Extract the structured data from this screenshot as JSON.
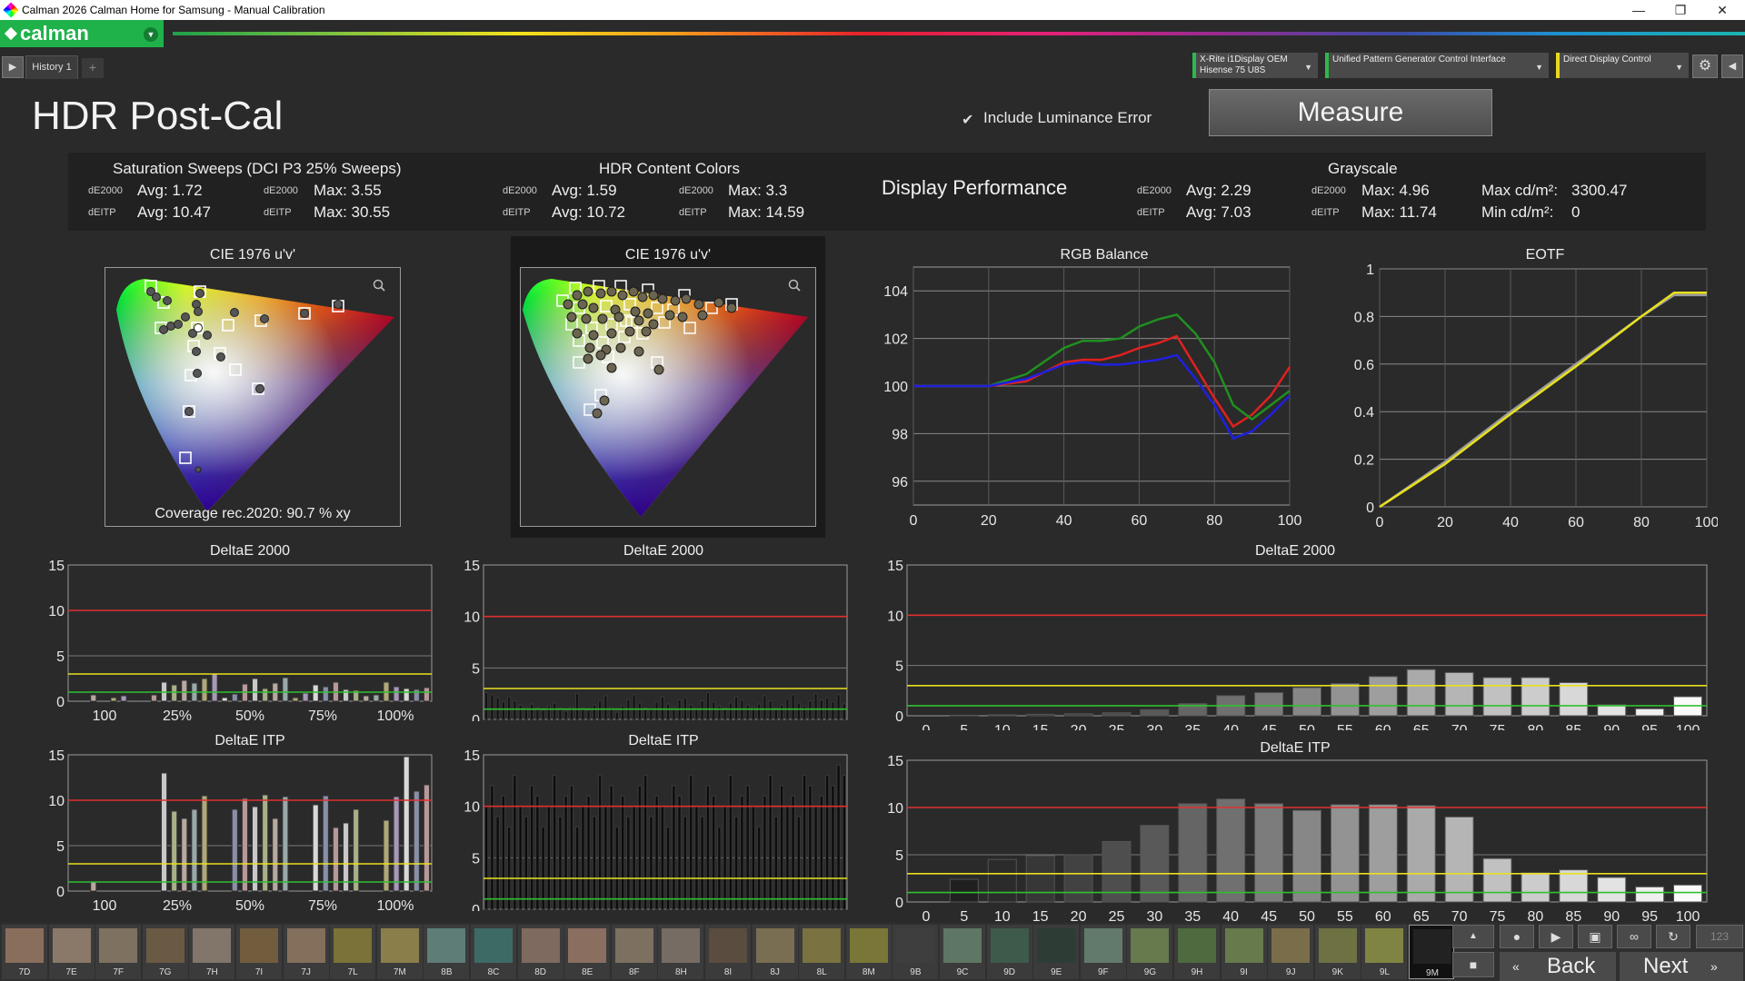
{
  "window": {
    "title": "Calman 2026 Calman Home for Samsung  - Manual Calibration",
    "minimize": "—",
    "maximize": "❐",
    "close": "✕"
  },
  "brand": {
    "logo_text": "calman",
    "accent": "#1fb24a"
  },
  "tabs": {
    "play_icon": "▶",
    "history_label": "History 1",
    "add_label": "+"
  },
  "devices": [
    {
      "line1": "X-Rite i1Display OEM",
      "line2": "Hisense 75 U8S"
    },
    {
      "line1": "Unified Pattern Generator Control Interface",
      "line2": ""
    },
    {
      "line1": "Direct Display Control",
      "line2": ""
    }
  ],
  "header": {
    "page_title": "HDR Post-Cal",
    "include_luminance_label": "Include Luminance Error",
    "include_luminance_checked": true,
    "measure_label": "Measure"
  },
  "summary": {
    "sat_sweeps": {
      "title": "Saturation Sweeps (DCI P3 25% Sweeps)",
      "de2000_label": "dE2000",
      "deitp_label": "dEITP",
      "de2000_avg": "Avg: 1.72",
      "de2000_max": "Max: 3.55",
      "deitp_avg": "Avg: 10.47",
      "deitp_max": "Max: 30.55"
    },
    "hdr_colors": {
      "title": "HDR Content Colors",
      "de2000_label": "dE2000",
      "deitp_label": "dEITP",
      "de2000_avg": "Avg: 1.59",
      "de2000_max": "Max: 3.3",
      "deitp_avg": "Avg: 10.72",
      "deitp_max": "Max: 14.59"
    },
    "display_performance": "Display Performance",
    "grayscale": {
      "title": "Grayscale",
      "de2000_label": "dE2000",
      "deitp_label": "dEITP",
      "de2000_avg": "Avg: 2.29",
      "de2000_max": "Max: 4.96",
      "deitp_avg": "Avg: 7.03",
      "deitp_max": "Max: 11.74",
      "max_cd_label": "Max cd/m²:",
      "max_cd": "3300.47",
      "min_cd_label": "Min cd/m²:",
      "min_cd": "0"
    }
  },
  "cie_left": {
    "title": "CIE 1976 u'v'",
    "coverage": "Coverage rec.2020:  90.7 % xy",
    "zoom_icon": "magnifier-icon"
  },
  "cie_right": {
    "title": "CIE 1976 u'v'",
    "zoom_icon": "magnifier-icon"
  },
  "panel_titles": {
    "rgb": "RGB Balance",
    "eotf": "EOTF",
    "sat_de2000": "DeltaE 2000",
    "sat_deitp": "DeltaE ITP",
    "hdr_de2000": "DeltaE 2000",
    "hdr_deitp": "DeltaE ITP",
    "gs_de2000": "DeltaE 2000",
    "gs_deitp": "DeltaE ITP"
  },
  "chart_data": [
    {
      "type": "line",
      "title": "RGB Balance",
      "x": [
        0,
        10,
        20,
        30,
        40,
        45,
        50,
        55,
        60,
        65,
        70,
        75,
        80,
        85,
        90,
        95,
        100
      ],
      "series": [
        {
          "color": "#e02020",
          "values": [
            100,
            100,
            100,
            100.2,
            101,
            101.1,
            101.1,
            101.3,
            101.6,
            101.8,
            102.1,
            100.8,
            99.5,
            98.3,
            98.8,
            99.6,
            100.8
          ]
        },
        {
          "color": "#209020",
          "values": [
            100,
            100,
            100,
            100.5,
            101.6,
            101.9,
            101.9,
            102,
            102.5,
            102.8,
            103,
            102.2,
            101,
            99.2,
            98.6,
            99.2,
            99.8
          ]
        },
        {
          "color": "#2020e0",
          "values": [
            100,
            100,
            100,
            100.3,
            100.9,
            101,
            100.9,
            100.9,
            101,
            101.1,
            101.3,
            100.3,
            99.2,
            97.8,
            98.1,
            98.8,
            99.6
          ]
        }
      ],
      "ylim": [
        95,
        105
      ],
      "yticks": [
        96,
        98,
        100,
        102,
        104
      ],
      "xlim": [
        0,
        100
      ],
      "xticks": [
        0,
        20,
        40,
        60,
        80,
        100
      ]
    },
    {
      "type": "line",
      "title": "EOTF",
      "x": [
        0,
        20,
        40,
        60,
        80,
        90,
        100
      ],
      "series": [
        {
          "color": "#9a9a9a",
          "values": [
            0,
            0.19,
            0.4,
            0.6,
            0.8,
            0.89,
            0.89
          ]
        },
        {
          "color": "#e8e020",
          "values": [
            0,
            0.18,
            0.39,
            0.59,
            0.8,
            0.9,
            0.9
          ]
        }
      ],
      "ylim": [
        0,
        1
      ],
      "yticks": [
        0,
        0.2,
        0.4,
        0.6,
        0.8,
        1
      ],
      "xlim": [
        0,
        100
      ],
      "xticks": [
        0,
        20,
        40,
        60,
        80,
        100
      ]
    },
    {
      "type": "bar",
      "title": "DeltaE 2000",
      "categories": [
        "100",
        "25%",
        "50%",
        "75%",
        "100%"
      ],
      "ylim": [
        0,
        15
      ],
      "yticks": [
        0,
        5,
        10,
        15
      ],
      "reference_lines": [
        {
          "value": 10,
          "color": "#e03030"
        },
        {
          "value": 3,
          "color": "#e8e020"
        },
        {
          "value": 1,
          "color": "#30c030"
        }
      ],
      "values": [
        0,
        0,
        0.7,
        0,
        0.4,
        0.6,
        0,
        0,
        0.7,
        2.1,
        1.8,
        2.3,
        2,
        2.5,
        3,
        0.4,
        0.8,
        1.9,
        2.5,
        1.4,
        2,
        2.6,
        0.4,
        0.9,
        1.8,
        1.6,
        2.1,
        1.3,
        1.2,
        0.6,
        0.7,
        2.1,
        1.6,
        1.4,
        1.3,
        1.5
      ]
    },
    {
      "type": "bar",
      "title": "DeltaE ITP",
      "categories": [
        "100",
        "25%",
        "50%",
        "75%",
        "100%"
      ],
      "ylim": [
        0,
        15
      ],
      "yticks": [
        0,
        5,
        10,
        15
      ],
      "reference_lines": [
        {
          "value": 10,
          "color": "#e03030"
        },
        {
          "value": 3,
          "color": "#e8e020"
        },
        {
          "value": 1,
          "color": "#30c030"
        }
      ],
      "values": [
        0,
        0,
        1,
        0,
        0,
        0,
        0,
        0,
        0,
        13,
        8.8,
        8,
        9,
        10.5,
        0,
        0,
        9,
        10.2,
        9.3,
        10.6,
        8,
        10.4,
        0,
        0,
        9.5,
        10.5,
        7,
        7.5,
        9,
        0,
        0,
        7.8,
        10.4,
        14.8,
        11,
        11.7
      ]
    },
    {
      "type": "bar",
      "title": "DeltaE 2000",
      "ylim": [
        0,
        15
      ],
      "yticks": [
        0,
        5,
        10,
        15
      ],
      "reference_lines": [
        {
          "value": 10,
          "color": "#e03030"
        },
        {
          "value": 3,
          "color": "#e8e020"
        },
        {
          "value": 1,
          "color": "#30c030"
        }
      ],
      "values": [
        2.6,
        2.4,
        2.1,
        1.7,
        2.2,
        1.8,
        1.4,
        1.2,
        1.5,
        1.1,
        0.9,
        1.3,
        1.6,
        1.1,
        0.8,
        1.2,
        2.5,
        1.1,
        0.9,
        1.4,
        1.8,
        2.3,
        1.2,
        0.7,
        1.3,
        1.9,
        2.4,
        1.6,
        1.1,
        1.0,
        1.7,
        2.2,
        1.5,
        1.2,
        1.9,
        2.1,
        1.4,
        1.0,
        1.8,
        2.6,
        1.7,
        1.3,
        1.1,
        1.6,
        2.2,
        1.9,
        1.4,
        1.2,
        1.5,
        2.3,
        1.8,
        1.1,
        1.4,
        2.0,
        2.4,
        1.6,
        1.3,
        1.8,
        2.5,
        1.9,
        2.1,
        1.7,
        2.4,
        1.5
      ]
    },
    {
      "type": "bar",
      "title": "DeltaE ITP",
      "ylim": [
        0,
        15
      ],
      "yticks": [
        0,
        5,
        10,
        15
      ],
      "reference_lines": [
        {
          "value": 10,
          "color": "#e03030"
        },
        {
          "value": 3,
          "color": "#e8e020"
        },
        {
          "value": 1,
          "color": "#30c030"
        }
      ],
      "values": [
        10,
        12,
        9,
        11,
        8,
        13,
        10,
        9,
        12,
        11,
        8,
        10,
        13,
        9,
        11,
        12,
        8,
        10,
        11,
        9,
        13,
        10,
        12,
        8,
        11,
        9,
        10,
        12,
        13,
        9,
        11,
        10,
        8,
        12,
        11,
        9,
        13,
        10,
        9,
        12,
        11,
        8,
        10,
        13,
        9,
        11,
        12,
        10,
        8,
        11,
        13,
        9,
        12,
        10,
        11,
        9,
        13,
        12,
        10,
        11,
        13,
        12,
        14,
        13
      ]
    },
    {
      "type": "bar",
      "title": "DeltaE 2000",
      "categories": [
        "0",
        "5",
        "10",
        "15",
        "20",
        "25",
        "30",
        "35",
        "40",
        "45",
        "50",
        "55",
        "60",
        "65",
        "70",
        "75",
        "80",
        "85",
        "90",
        "95",
        "100"
      ],
      "values": [
        0,
        0.05,
        0.1,
        0.15,
        0.2,
        0.3,
        0.6,
        1.2,
        2,
        2.3,
        2.8,
        3.2,
        3.9,
        4.6,
        4.3,
        3.8,
        3.8,
        3.3,
        1.1,
        0.7,
        1.9
      ],
      "ylim": [
        0,
        15
      ],
      "yticks": [
        0,
        5,
        10,
        15
      ],
      "reference_lines": [
        {
          "value": 10,
          "color": "#e03030"
        },
        {
          "value": 3,
          "color": "#e8e020"
        },
        {
          "value": 1,
          "color": "#30c030"
        }
      ]
    },
    {
      "type": "bar",
      "title": "DeltaE ITP",
      "categories": [
        "0",
        "5",
        "10",
        "15",
        "20",
        "25",
        "30",
        "35",
        "40",
        "45",
        "50",
        "55",
        "60",
        "65",
        "70",
        "75",
        "80",
        "85",
        "90",
        "95",
        "100"
      ],
      "values": [
        0,
        2.4,
        4.5,
        4.9,
        5,
        6.4,
        8.1,
        10.4,
        10.9,
        10.4,
        9.7,
        10.3,
        10.3,
        10.2,
        9,
        4.6,
        3.1,
        3.4,
        2.6,
        1.6,
        1.8
      ],
      "ylim": [
        0,
        15
      ],
      "yticks": [
        0,
        5,
        10,
        15
      ],
      "reference_lines": [
        {
          "value": 10,
          "color": "#e03030"
        },
        {
          "value": 3,
          "color": "#e8e020"
        },
        {
          "value": 1,
          "color": "#30c030"
        }
      ]
    }
  ],
  "patches": [
    {
      "label": "7D",
      "color": "#8a6e5c"
    },
    {
      "label": "7E",
      "color": "#8a7868"
    },
    {
      "label": "7F",
      "color": "#7e7160"
    },
    {
      "label": "7G",
      "color": "#6a5a44"
    },
    {
      "label": "7H",
      "color": "#82756a"
    },
    {
      "label": "7I",
      "color": "#725c3e"
    },
    {
      "label": "7J",
      "color": "#846e5c"
    },
    {
      "label": "7L",
      "color": "#7a7238"
    },
    {
      "label": "7M",
      "color": "#8a7e4a"
    },
    {
      "label": "8B",
      "color": "#5d7d76"
    },
    {
      "label": "8C",
      "color": "#3e6a66"
    },
    {
      "label": "8D",
      "color": "#7e6a5e"
    },
    {
      "label": "8E",
      "color": "#8a6e60"
    },
    {
      "label": "8F",
      "color": "#7e7060"
    },
    {
      "label": "8H",
      "color": "#766c64"
    },
    {
      "label": "8I",
      "color": "#5a4c3e"
    },
    {
      "label": "8J",
      "color": "#7a6e52"
    },
    {
      "label": "8L",
      "color": "#7a7240"
    },
    {
      "label": "8M",
      "color": "#7a7638"
    },
    {
      "label": "9B",
      "color": "#3e3e3e"
    },
    {
      "label": "9C",
      "color": "#5e7664"
    },
    {
      "label": "9D",
      "color": "#3e5a4a"
    },
    {
      "label": "9E",
      "color": "#2e3c36"
    },
    {
      "label": "9F",
      "color": "#627a6c"
    },
    {
      "label": "9G",
      "color": "#667a4e"
    },
    {
      "label": "9H",
      "color": "#4e6a3e"
    },
    {
      "label": "9I",
      "color": "#667a4c"
    },
    {
      "label": "9J",
      "color": "#7a6e4a"
    },
    {
      "label": "9K",
      "color": "#6e7242"
    },
    {
      "label": "9L",
      "color": "#808442"
    },
    {
      "label": "9M",
      "color": "#222222"
    }
  ],
  "nav": {
    "back": "Back",
    "next": "Next",
    "counter": "123"
  }
}
